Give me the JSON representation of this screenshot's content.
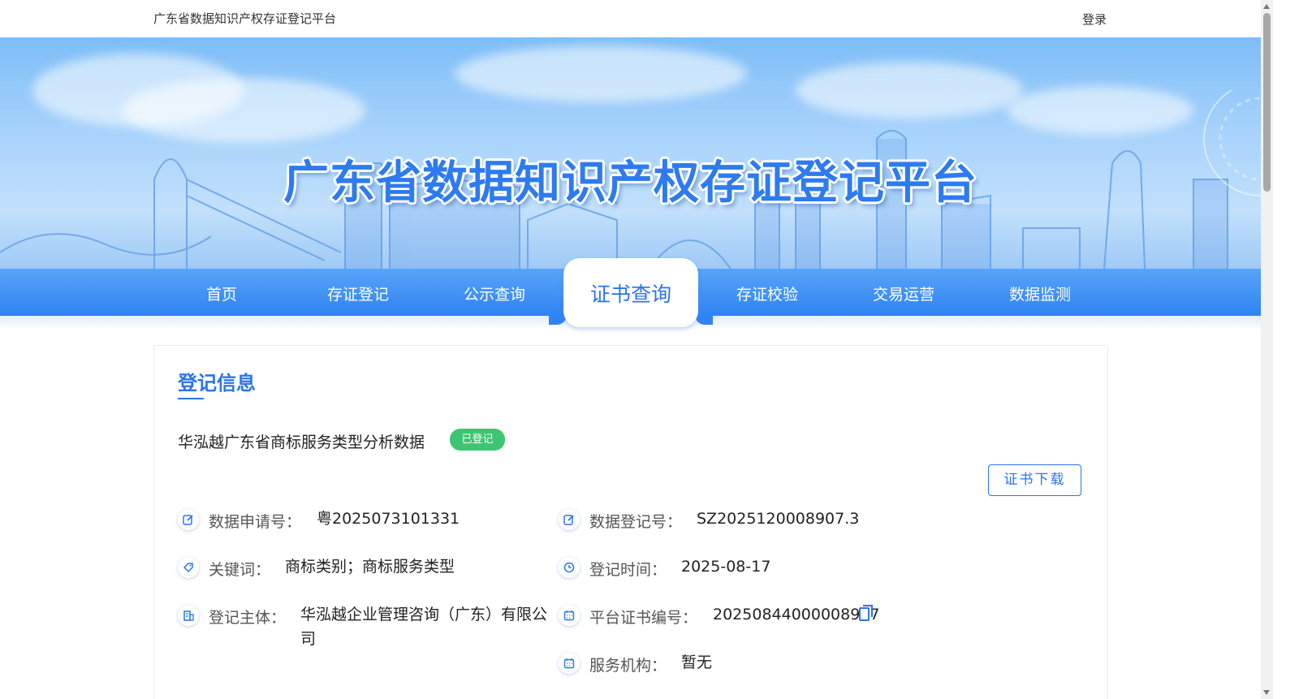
{
  "topbar": {
    "site_name": "广东省数据知识产权存证登记平台",
    "login_label": "登录"
  },
  "banner": {
    "title": "广东省数据知识产权存证登记平台"
  },
  "nav": {
    "items": [
      {
        "label": "首页"
      },
      {
        "label": "存证登记"
      },
      {
        "label": "公示查询"
      },
      {
        "label": "证书查询",
        "active": true
      },
      {
        "label": "存证校验"
      },
      {
        "label": "交易运营"
      },
      {
        "label": "数据监测"
      }
    ]
  },
  "section": {
    "title": "登记信息"
  },
  "record": {
    "title": "华泓越广东省商标服务类型分析数据",
    "status": "已登记",
    "download_label": "证书下载"
  },
  "fields": {
    "apply_no": {
      "label": "数据申请号：",
      "value": "粤2025073101331",
      "icon": "edit-icon"
    },
    "register_no": {
      "label": "数据登记号：",
      "value": "SZ2025120008907.3",
      "icon": "edit-icon"
    },
    "keywords": {
      "label": "关键词：",
      "value": "商标类别；商标服务类型",
      "icon": "tag-icon"
    },
    "register_time": {
      "label": "登记时间：",
      "value": "2025-08-17",
      "icon": "clock-icon"
    },
    "subject": {
      "label": "登记主体：",
      "value": "华泓越企业管理咨询（广东）有限公司",
      "icon": "building-icon"
    },
    "cert_no": {
      "label": "平台证书编号：",
      "value": "20250844000008907",
      "icon": "calendar-icon"
    },
    "service_org": {
      "label": "服务机构：",
      "value": "暂无",
      "icon": "calendar-icon"
    }
  },
  "colors": {
    "accent": "#2b74ea",
    "status_green": "#3ec574",
    "nav_blue": "#2f83f3"
  }
}
